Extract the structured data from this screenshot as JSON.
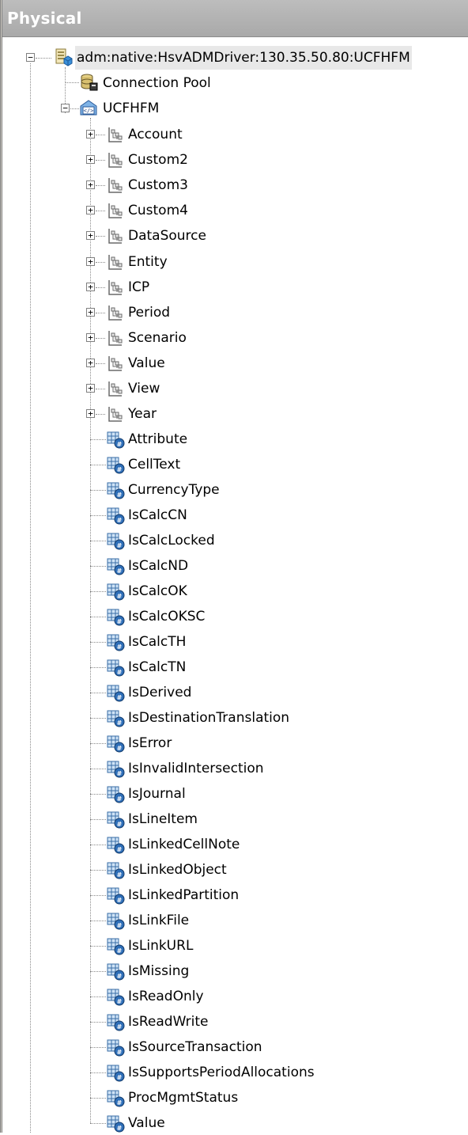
{
  "panel": {
    "title": "Physical"
  },
  "tree": {
    "database": {
      "label": "adm:native:HsvADMDriver:130.35.50.80:UCFHFM",
      "icon": "database-icon",
      "expanded": true
    },
    "connection_pool": {
      "label": "Connection Pool",
      "icon": "connection-pool-icon"
    },
    "catalog": {
      "label": "UCFHFM",
      "icon": "catalog-icon",
      "expanded": true
    },
    "dimensions": [
      {
        "label": "Account",
        "icon": "dimension-hierarchy-icon",
        "expanded": false
      },
      {
        "label": "Custom2",
        "icon": "dimension-hierarchy-icon",
        "expanded": false
      },
      {
        "label": "Custom3",
        "icon": "dimension-hierarchy-icon",
        "expanded": false
      },
      {
        "label": "Custom4",
        "icon": "dimension-hierarchy-icon",
        "expanded": false
      },
      {
        "label": "DataSource",
        "icon": "dimension-hierarchy-icon",
        "expanded": false
      },
      {
        "label": "Entity",
        "icon": "dimension-hierarchy-icon",
        "expanded": false
      },
      {
        "label": "ICP",
        "icon": "dimension-hierarchy-icon",
        "expanded": false
      },
      {
        "label": "Period",
        "icon": "dimension-hierarchy-icon",
        "expanded": false
      },
      {
        "label": "Scenario",
        "icon": "dimension-hierarchy-icon",
        "expanded": false
      },
      {
        "label": "Value",
        "icon": "dimension-hierarchy-icon",
        "expanded": false
      },
      {
        "label": "View",
        "icon": "dimension-hierarchy-icon",
        "expanded": false
      },
      {
        "label": "Year",
        "icon": "dimension-hierarchy-icon",
        "expanded": false
      }
    ],
    "measures": [
      {
        "label": "Attribute",
        "icon": "measure-column-icon"
      },
      {
        "label": "CellText",
        "icon": "measure-column-icon"
      },
      {
        "label": "CurrencyType",
        "icon": "measure-column-icon"
      },
      {
        "label": "IsCalcCN",
        "icon": "measure-column-icon"
      },
      {
        "label": "IsCalcLocked",
        "icon": "measure-column-icon"
      },
      {
        "label": "IsCalcND",
        "icon": "measure-column-icon"
      },
      {
        "label": "IsCalcOK",
        "icon": "measure-column-icon"
      },
      {
        "label": "IsCalcOKSC",
        "icon": "measure-column-icon"
      },
      {
        "label": "IsCalcTH",
        "icon": "measure-column-icon"
      },
      {
        "label": "IsCalcTN",
        "icon": "measure-column-icon"
      },
      {
        "label": "IsDerived",
        "icon": "measure-column-icon"
      },
      {
        "label": "IsDestinationTranslation",
        "icon": "measure-column-icon"
      },
      {
        "label": "IsError",
        "icon": "measure-column-icon"
      },
      {
        "label": "IsInvalidIntersection",
        "icon": "measure-column-icon"
      },
      {
        "label": "IsJournal",
        "icon": "measure-column-icon"
      },
      {
        "label": "IsLineItem",
        "icon": "measure-column-icon"
      },
      {
        "label": "IsLinkedCellNote",
        "icon": "measure-column-icon"
      },
      {
        "label": "IsLinkedObject",
        "icon": "measure-column-icon"
      },
      {
        "label": "IsLinkedPartition",
        "icon": "measure-column-icon"
      },
      {
        "label": "IsLinkFile",
        "icon": "measure-column-icon"
      },
      {
        "label": "IsLinkURL",
        "icon": "measure-column-icon"
      },
      {
        "label": "IsMissing",
        "icon": "measure-column-icon"
      },
      {
        "label": "IsReadOnly",
        "icon": "measure-column-icon"
      },
      {
        "label": "IsReadWrite",
        "icon": "measure-column-icon"
      },
      {
        "label": "IsSourceTransaction",
        "icon": "measure-column-icon"
      },
      {
        "label": "IsSupportsPeriodAllocations",
        "icon": "measure-column-icon"
      },
      {
        "label": "ProcMgmtStatus",
        "icon": "measure-column-icon"
      },
      {
        "label": "Value",
        "icon": "measure-column-icon"
      }
    ]
  },
  "colors": {
    "title_bar": "#b4b4b4",
    "title_text": "#ffffff",
    "tree_lines": "#8a8a8a",
    "selection": "#e8e8e8"
  }
}
